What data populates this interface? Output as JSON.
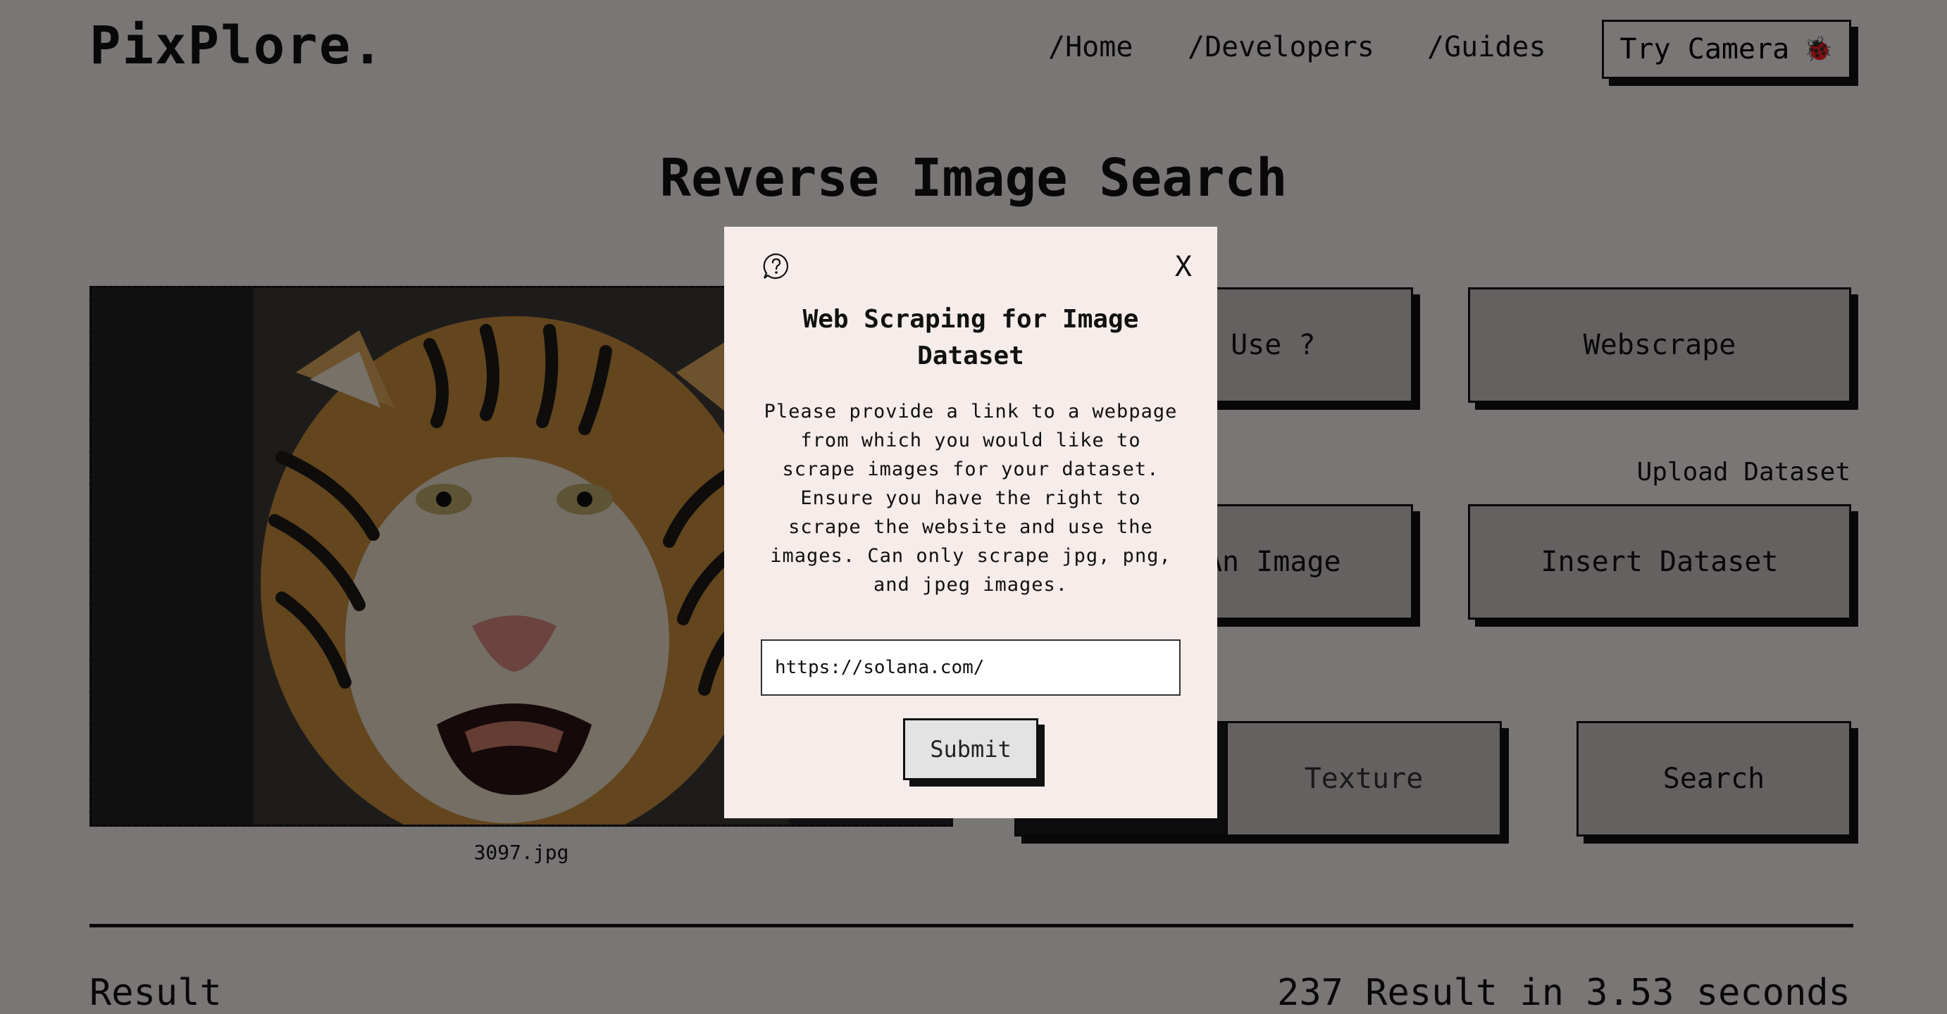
{
  "header": {
    "logo": "PixPlore.",
    "nav": [
      "/Home",
      "/Developers",
      "/Guides"
    ],
    "camera_label": "Try Camera",
    "camera_icon": "🐞"
  },
  "main": {
    "title": "Reverse Image Search",
    "image_filename": "3097.jpg",
    "buttons": {
      "how_to_use": "How To Use ?",
      "webscrape": "Webscrape",
      "upload_dataset_label": "Upload Dataset",
      "insert_image": "Insert An Image",
      "insert_dataset": "Insert Dataset",
      "texture": "Texture",
      "search": "Search"
    },
    "result_label": "Result",
    "result_stats": "237 Result in 3.53 seconds"
  },
  "modal": {
    "title": "Web Scraping for Image Dataset",
    "description": "Please provide a link to a webpage from which you would like to scrape images for your dataset. Ensure you have the right to scrape the website and use the images. Can only scrape jpg, png, and jpeg images.",
    "url_value": "https://solana.com/",
    "close_label": "X",
    "submit_label": "Submit"
  }
}
